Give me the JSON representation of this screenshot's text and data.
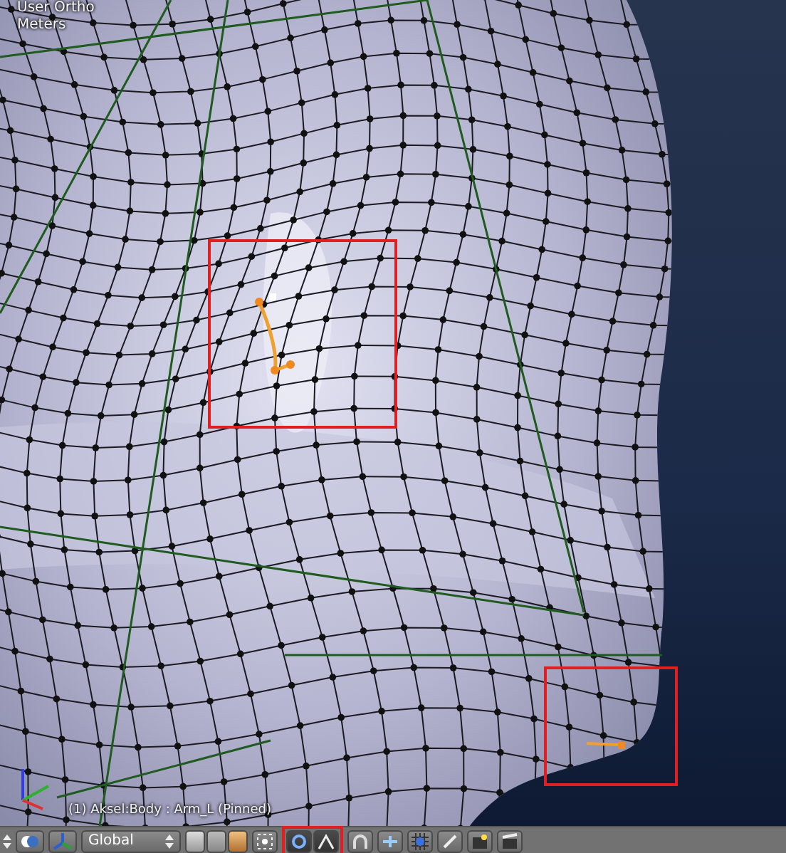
{
  "viewport": {
    "view_label": "User Ortho",
    "units": "Meters",
    "object_info": "(1) Aksel:Body : Arm_L (Pinned)"
  },
  "header": {
    "orientation": "Global"
  }
}
